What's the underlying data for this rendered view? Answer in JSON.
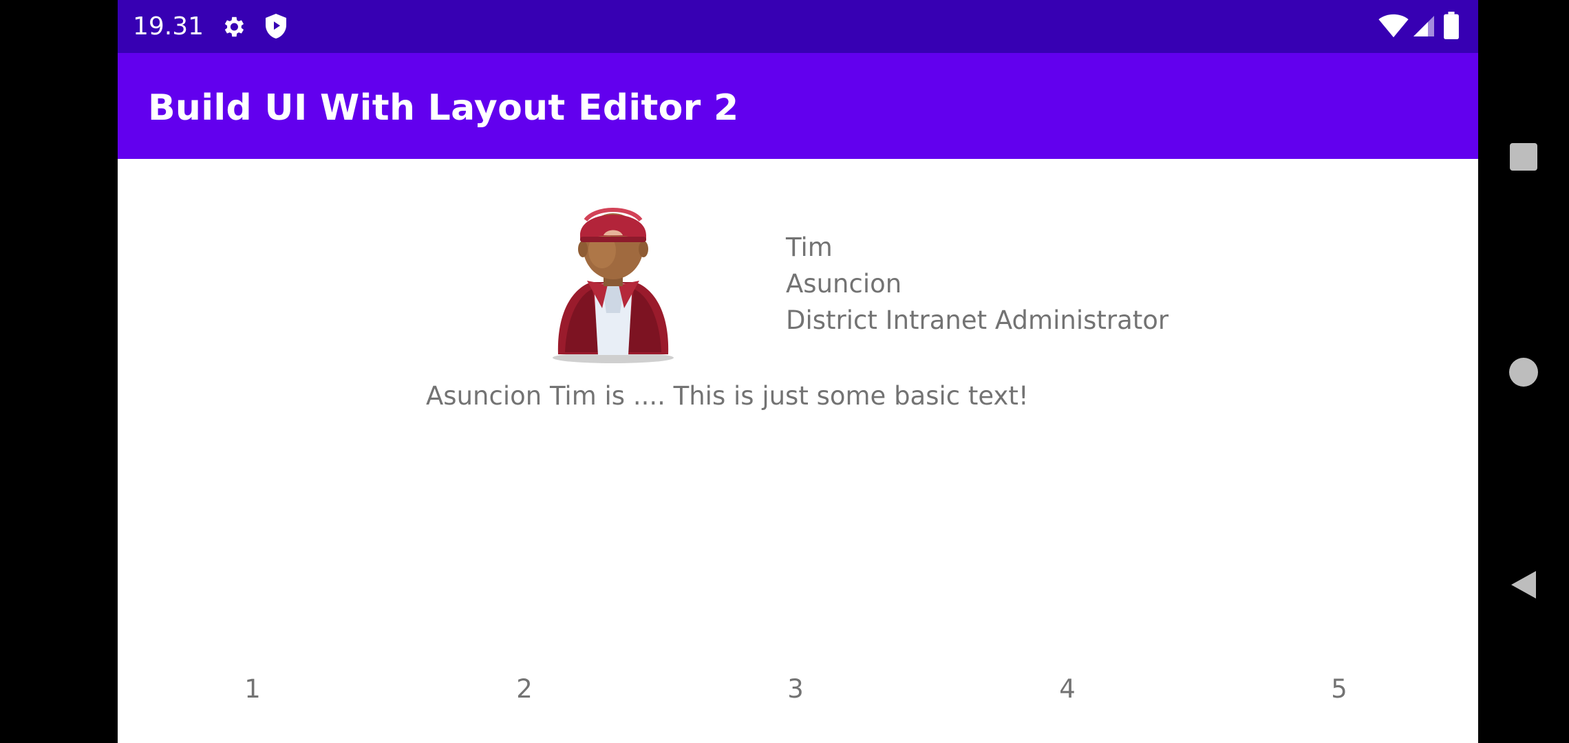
{
  "status_bar": {
    "time": "19.31",
    "icons": [
      "gear-icon",
      "shield-icon",
      "wifi-icon",
      "signal-icon",
      "battery-icon"
    ]
  },
  "app_bar": {
    "title": "Build UI With Layout Editor 2",
    "color": "#6200ee"
  },
  "profile": {
    "avatar_icon": "person-avatar-icon",
    "first_name": "Tim",
    "last_name": "Asuncion",
    "job_title": "District Intranet Administrator",
    "bio": "Asuncion Tim is .... This is just some basic text!"
  },
  "numbers": [
    "1",
    "2",
    "3",
    "4",
    "5"
  ],
  "nav_bar": {
    "icons": [
      "recents-icon",
      "home-icon",
      "back-icon"
    ]
  },
  "colors": {
    "status_bar": "#3700b3",
    "app_bar": "#6200ee",
    "text": "#737373"
  }
}
